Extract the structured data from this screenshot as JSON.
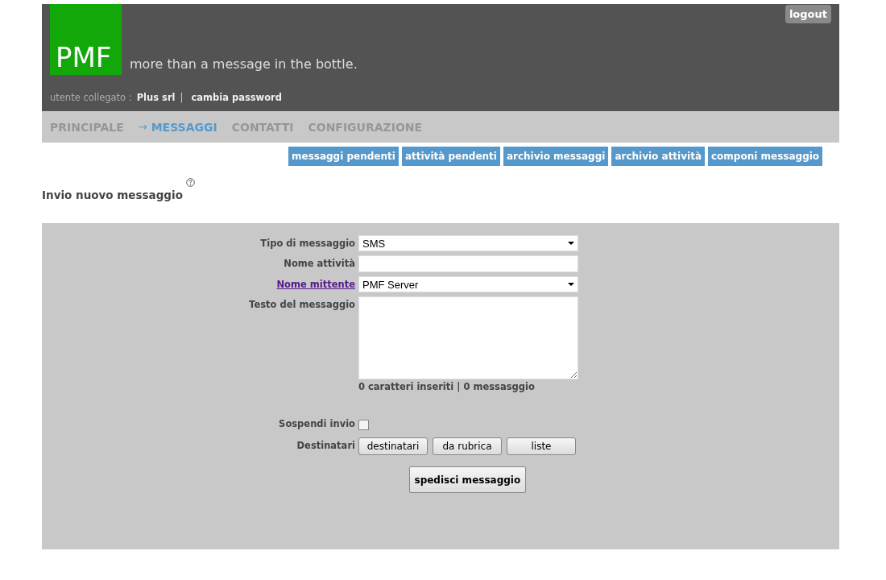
{
  "header": {
    "logo": "PMF",
    "tagline": "more than a message in the bottle.",
    "logout": "logout",
    "user_label": "utente collegato :",
    "user_name": "Plus srl",
    "separator": "|",
    "change_password": "cambia password"
  },
  "nav": {
    "marker": "→",
    "items": [
      {
        "label": "PRINCIPALE",
        "selected": false
      },
      {
        "label": "MESSAGGI",
        "selected": true
      },
      {
        "label": "CONTATTI",
        "selected": false
      },
      {
        "label": "CONFIGURAZIONE",
        "selected": false
      }
    ]
  },
  "subnav": [
    "messaggi pendenti",
    "attività pendenti",
    "archivio messaggi",
    "archivio attività",
    "componi messaggio"
  ],
  "page_title": "Invio nuovo messaggio",
  "form": {
    "rows": [
      {
        "kind": "select",
        "label": "Tipo di messaggio",
        "label_link": false,
        "value": "SMS"
      },
      {
        "kind": "text",
        "label": "Nome attività",
        "label_link": false
      },
      {
        "kind": "select",
        "label": "Nome mittente",
        "label_link": true,
        "value": "PMF Server"
      },
      {
        "kind": "textarea",
        "label": "Testo del messaggio",
        "label_link": false,
        "counter": "0 caratteri inseriti | 0 messasggio"
      },
      {
        "kind": "checkbox",
        "label": "Sospendi invio",
        "label_link": false,
        "checked": false
      },
      {
        "kind": "buttons",
        "label": "Destinatari",
        "label_link": false,
        "buttons": [
          "destinatari",
          "da rubrica",
          "liste"
        ]
      }
    ],
    "submit": "spedisci messaggio"
  }
}
